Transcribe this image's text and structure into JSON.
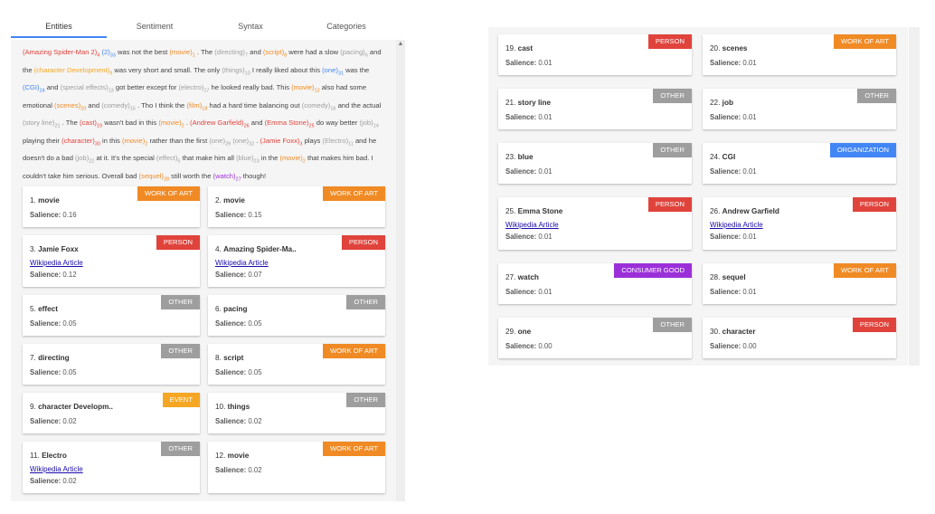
{
  "tabs": [
    "Entities",
    "Sentiment",
    "Syntax",
    "Categories"
  ],
  "active_tab": "Entities",
  "salience_label": "Salience:",
  "wiki_label": "Wikipedia Article",
  "text_segments": [
    {
      "t": "(Amazing Spider-Man 2)",
      "c": "person"
    },
    {
      "t": "4",
      "s": 1,
      "c": "person"
    },
    {
      "t": " (2)",
      "c": "org"
    },
    {
      "t": "33",
      "s": 1,
      "c": "org"
    },
    {
      "t": " was not the best "
    },
    {
      "t": "(movie)",
      "c": "work"
    },
    {
      "t": "1",
      "s": 1,
      "c": "work"
    },
    {
      "t": " . The "
    },
    {
      "t": "(directing)",
      "c": "other"
    },
    {
      "t": "7",
      "s": 1,
      "c": "other"
    },
    {
      "t": " and "
    },
    {
      "t": "(script)",
      "c": "work"
    },
    {
      "t": "8",
      "s": 1,
      "c": "work"
    },
    {
      "t": " were had a slow "
    },
    {
      "t": "(pacing)",
      "c": "other"
    },
    {
      "t": "6",
      "s": 1,
      "c": "other"
    },
    {
      "t": " and the "
    },
    {
      "t": "(character Development)",
      "c": "event"
    },
    {
      "t": "9",
      "s": 1,
      "c": "event"
    },
    {
      "t": " was very short and small. The only "
    },
    {
      "t": "(things)",
      "c": "other"
    },
    {
      "t": "10",
      "s": 1,
      "c": "other"
    },
    {
      "t": " I really liked about this "
    },
    {
      "t": "(one)",
      "c": "org"
    },
    {
      "t": "31",
      "s": 1,
      "c": "org"
    },
    {
      "t": " was the "
    },
    {
      "t": "(CGI)",
      "c": "org"
    },
    {
      "t": "24",
      "s": 1,
      "c": "org"
    },
    {
      "t": " and "
    },
    {
      "t": "(special effects)",
      "c": "other"
    },
    {
      "t": "13",
      "s": 1,
      "c": "other"
    },
    {
      "t": " got better except for "
    },
    {
      "t": "(electro)",
      "c": "other"
    },
    {
      "t": "17",
      "s": 1,
      "c": "other"
    },
    {
      "t": " he looked really bad. This "
    },
    {
      "t": "(movie)",
      "c": "work"
    },
    {
      "t": "12",
      "s": 1,
      "c": "work"
    },
    {
      "t": " also had some emotional "
    },
    {
      "t": "(scenes)",
      "c": "work"
    },
    {
      "t": "20",
      "s": 1,
      "c": "work"
    },
    {
      "t": " and "
    },
    {
      "t": "(comedy)",
      "c": "other"
    },
    {
      "t": "15",
      "s": 1,
      "c": "other"
    },
    {
      "t": " . Tho I think the "
    },
    {
      "t": "(film)",
      "c": "work"
    },
    {
      "t": "18",
      "s": 1,
      "c": "work"
    },
    {
      "t": " had a hard time balancing out "
    },
    {
      "t": "(comedy)",
      "c": "other"
    },
    {
      "t": "16",
      "s": 1,
      "c": "other"
    },
    {
      "t": " and the actual "
    },
    {
      "t": "(story line)",
      "c": "other"
    },
    {
      "t": "21",
      "s": 1,
      "c": "other"
    },
    {
      "t": " . The "
    },
    {
      "t": "(cast)",
      "c": "person"
    },
    {
      "t": "19",
      "s": 1,
      "c": "person"
    },
    {
      "t": " wasn't bad in this "
    },
    {
      "t": "(movie)",
      "c": "work"
    },
    {
      "t": "2",
      "s": 1,
      "c": "work"
    },
    {
      "t": " . "
    },
    {
      "t": "(Andrew Garfield)",
      "c": "person"
    },
    {
      "t": "26",
      "s": 1,
      "c": "person"
    },
    {
      "t": " and "
    },
    {
      "t": "(Emma Stone)",
      "c": "person"
    },
    {
      "t": "25",
      "s": 1,
      "c": "person"
    },
    {
      "t": " do way better "
    },
    {
      "t": "(job)",
      "c": "other"
    },
    {
      "t": "14",
      "s": 1,
      "c": "other"
    },
    {
      "t": " playing their "
    },
    {
      "t": "(character)",
      "c": "person"
    },
    {
      "t": "30",
      "s": 1,
      "c": "person"
    },
    {
      "t": " in this "
    },
    {
      "t": "(movie)",
      "c": "work"
    },
    {
      "t": "2",
      "s": 1,
      "c": "work"
    },
    {
      "t": " rather than the first "
    },
    {
      "t": "(one)",
      "c": "other"
    },
    {
      "t": "29",
      "s": 1,
      "c": "other"
    },
    {
      "t": " "
    },
    {
      "t": "(one)",
      "c": "other"
    },
    {
      "t": "32",
      "s": 1,
      "c": "other"
    },
    {
      "t": " . "
    },
    {
      "t": "(Jamie Foxx)",
      "c": "person"
    },
    {
      "t": "3",
      "s": 1,
      "c": "person"
    },
    {
      "t": " plays "
    },
    {
      "t": "(Electro)",
      "c": "other"
    },
    {
      "t": "11",
      "s": 1,
      "c": "other"
    },
    {
      "t": " and he doesn't do a bad "
    },
    {
      "t": "(job)",
      "c": "other"
    },
    {
      "t": "22",
      "s": 1,
      "c": "other"
    },
    {
      "t": " at it. It's the special "
    },
    {
      "t": "(effect)",
      "c": "other"
    },
    {
      "t": "5",
      "s": 1,
      "c": "other"
    },
    {
      "t": " that make him all "
    },
    {
      "t": "(blue)",
      "c": "other"
    },
    {
      "t": "23",
      "s": 1,
      "c": "other"
    },
    {
      "t": " in the "
    },
    {
      "t": "(movie)",
      "c": "work"
    },
    {
      "t": "2",
      "s": 1,
      "c": "work"
    },
    {
      "t": " that makes him bad. I couldn't take him serious. Overall bad "
    },
    {
      "t": "(sequel)",
      "c": "work"
    },
    {
      "t": "28",
      "s": 1,
      "c": "work"
    },
    {
      "t": " still worth the "
    },
    {
      "t": "(watch)",
      "c": "good"
    },
    {
      "t": "27",
      "s": 1,
      "c": "good"
    },
    {
      "t": " though!"
    }
  ],
  "left_cards": [
    {
      "n": "1.",
      "name": "movie",
      "type": "work",
      "label": "WORK OF ART",
      "sal": "0.16"
    },
    {
      "n": "2.",
      "name": "movie",
      "type": "work",
      "label": "WORK OF ART",
      "sal": "0.15"
    },
    {
      "n": "3.",
      "name": "Jamie Foxx",
      "type": "person",
      "label": "PERSON",
      "sal": "0.12",
      "wiki": true
    },
    {
      "n": "4.",
      "name": "Amazing Spider-Ma..",
      "type": "person",
      "label": "PERSON",
      "sal": "0.07",
      "wiki": true
    },
    {
      "n": "5.",
      "name": "effect",
      "type": "other",
      "label": "OTHER",
      "sal": "0.05"
    },
    {
      "n": "6.",
      "name": "pacing",
      "type": "other",
      "label": "OTHER",
      "sal": "0.05"
    },
    {
      "n": "7.",
      "name": "directing",
      "type": "other",
      "label": "OTHER",
      "sal": "0.05"
    },
    {
      "n": "8.",
      "name": "script",
      "type": "work",
      "label": "WORK OF ART",
      "sal": "0.05"
    },
    {
      "n": "9.",
      "name": "character Developm..",
      "type": "event",
      "label": "EVENT",
      "sal": "0.02"
    },
    {
      "n": "10.",
      "name": "things",
      "type": "other",
      "label": "OTHER",
      "sal": "0.02"
    },
    {
      "n": "11.",
      "name": "Electro",
      "type": "other",
      "label": "OTHER",
      "sal": "0.02",
      "wiki": true
    },
    {
      "n": "12.",
      "name": "movie",
      "type": "work",
      "label": "WORK OF ART",
      "sal": "0.02"
    }
  ],
  "right_cards": [
    {
      "n": "19.",
      "name": "cast",
      "type": "person",
      "label": "PERSON",
      "sal": "0.01"
    },
    {
      "n": "20.",
      "name": "scenes",
      "type": "work",
      "label": "WORK OF ART",
      "sal": "0.01"
    },
    {
      "n": "21.",
      "name": "story line",
      "type": "other",
      "label": "OTHER",
      "sal": "0.01"
    },
    {
      "n": "22.",
      "name": "job",
      "type": "other",
      "label": "OTHER",
      "sal": "0.01"
    },
    {
      "n": "23.",
      "name": "blue",
      "type": "other",
      "label": "OTHER",
      "sal": "0.01"
    },
    {
      "n": "24.",
      "name": "CGI",
      "type": "org",
      "label": "ORGANIZATION",
      "sal": "0.01"
    },
    {
      "n": "25.",
      "name": "Emma Stone",
      "type": "person",
      "label": "PERSON",
      "sal": "0.01",
      "wiki": true
    },
    {
      "n": "26.",
      "name": "Andrew Garfield",
      "type": "person",
      "label": "PERSON",
      "sal": "0.01",
      "wiki": true
    },
    {
      "n": "27.",
      "name": "watch",
      "type": "good",
      "label": "CONSUMER GOOD",
      "sal": "0.01"
    },
    {
      "n": "28.",
      "name": "sequel",
      "type": "work",
      "label": "WORK OF ART",
      "sal": "0.01"
    },
    {
      "n": "29.",
      "name": "one",
      "type": "other",
      "label": "OTHER",
      "sal": "0.00"
    },
    {
      "n": "30.",
      "name": "character",
      "type": "person",
      "label": "PERSON",
      "sal": "0.00"
    }
  ],
  "colors": {
    "person": "#e0433b",
    "work": "#f08a24",
    "other": "#9e9e9e",
    "event": "#f5a623",
    "org": "#4285f4",
    "good": "#9b30d9",
    "link": "#1a0dab",
    "tab_active": "#4285f4"
  }
}
